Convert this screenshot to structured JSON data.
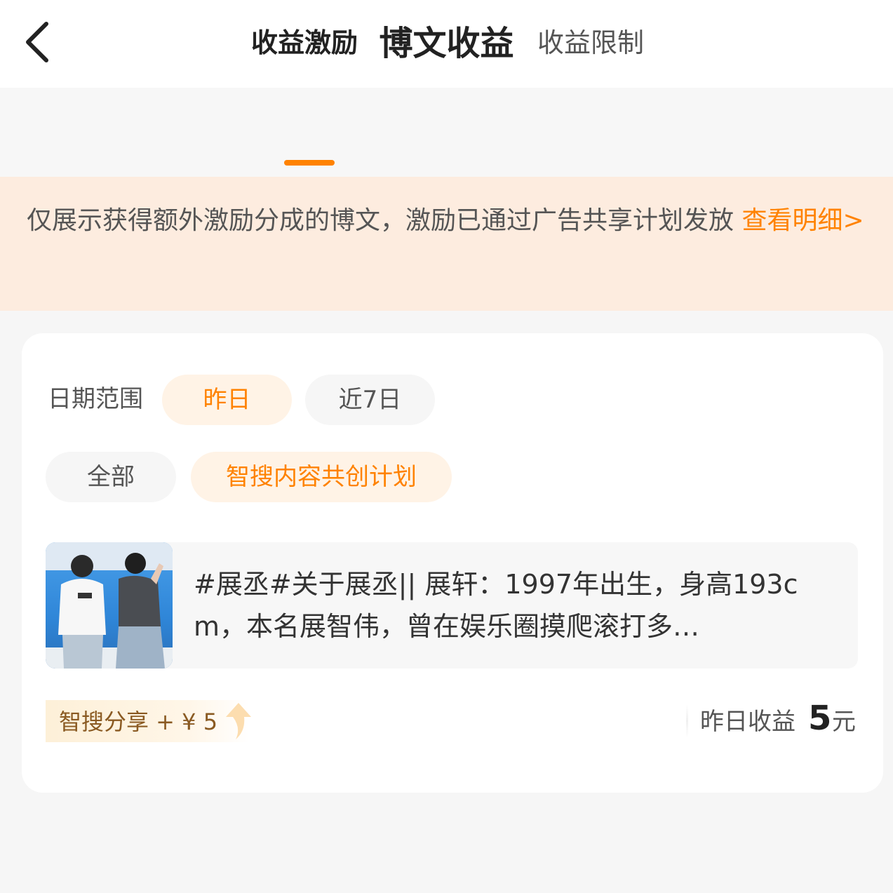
{
  "header": {
    "title": "博文收益"
  },
  "tabs": [
    {
      "label": "收益激励",
      "active": true
    },
    {
      "label": "收益限制",
      "active": false
    }
  ],
  "notice": {
    "text": "仅展示获得额外激励分成的博文，激励已通过广告共享计划发放 ",
    "link_label": "查看明细>"
  },
  "filters": {
    "date_label": "日期范围",
    "date_options": [
      {
        "label": "昨日",
        "selected": true
      },
      {
        "label": "近7日",
        "selected": false
      }
    ],
    "type_options": [
      {
        "label": "全部",
        "selected": false
      },
      {
        "label": "智搜内容共创计划",
        "selected": true
      }
    ]
  },
  "post": {
    "text": "#展丞#关于展丞|| 展轩：1997年出生，身高193cm，本名展智伟，曾在娱乐圈摸爬滚打多…",
    "badge": "智搜分享 + ¥ 5",
    "earnings_label": "昨日收益",
    "earnings_value": "5",
    "earnings_unit": "元"
  },
  "colors": {
    "accent": "#ff8200",
    "notice_bg": "#fdecdf",
    "chip_selected_bg": "#fff3e6"
  },
  "icons": {
    "back": "chevron-left-icon",
    "badge_arrow": "arrow-up-icon"
  }
}
